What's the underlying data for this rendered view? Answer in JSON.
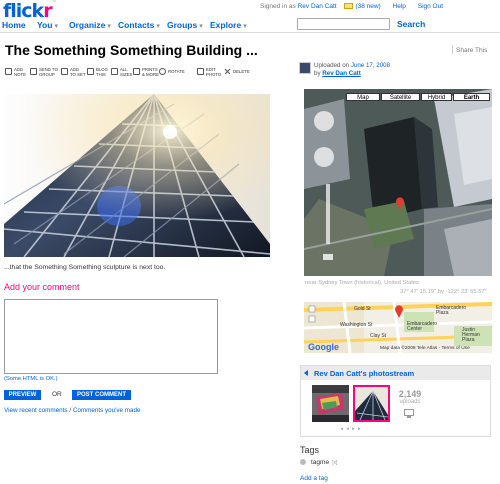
{
  "logo": {
    "part1": "flick",
    "part2": "r",
    "mark": "™"
  },
  "account": {
    "signed_in_as": "Signed in as",
    "user": "Rev Dan Catt",
    "mail_count": "(38 new)",
    "help": "Help",
    "sign_out": "Sign Out"
  },
  "nav": {
    "items": [
      {
        "label": "Home",
        "caret": false
      },
      {
        "label": "You",
        "caret": true
      },
      {
        "label": "Organize",
        "caret": true
      },
      {
        "label": "Contacts",
        "caret": true
      },
      {
        "label": "Groups",
        "caret": true
      },
      {
        "label": "Explore",
        "caret": true
      }
    ],
    "search_placeholder": "",
    "search_label": "Search",
    "caret_glyph": "▾"
  },
  "photo": {
    "title": "The Something Something Building ...",
    "caption": "...that the Something Something sculpture is next too.",
    "share_label": "Share This"
  },
  "toolbar": {
    "items": [
      {
        "label": "ADD\nNOTE",
        "icon": "note-icon"
      },
      {
        "label": "SEND TO\nGROUP",
        "icon": "group-icon"
      },
      {
        "label": "ADD\nTO SET",
        "icon": "set-icon"
      },
      {
        "label": "BLOG\nTHIS",
        "icon": "blog-icon"
      },
      {
        "label": "ALL\nSIZES",
        "icon": "sizes-icon"
      },
      {
        "label": "PRINTS\n& MORE",
        "icon": "prints-icon"
      },
      {
        "label": "ROTATE",
        "icon": "rotate-icon"
      },
      {
        "label": "EDIT\nPHOTO",
        "icon": "edit-icon"
      },
      {
        "label": "DELETE",
        "icon": "delete-icon"
      }
    ]
  },
  "comments": {
    "heading": "Add your comment",
    "html_note": "(Some HTML is OK.)",
    "preview_label": "PREVIEW",
    "or_label": "OR",
    "post_label": "POST COMMENT",
    "recent_link": "View recent comments",
    "separator": " / ",
    "yours_link": "Comments you've made"
  },
  "sidebar": {
    "uploaded_prefix": "Uploaded on",
    "uploaded_date": "June 17, 2008",
    "by_prefix": "by",
    "author": "Rev Dan Catt",
    "map_tabs": [
      "Map",
      "Satellite",
      "Hybrid",
      "Earth"
    ],
    "map_active_tab": "Earth",
    "location": "near Sydney Town (historical), United States",
    "coordinates": "37° 47' 15.19\" by -122° 23' 55.57\"",
    "street_labels": {
      "gold": "Gold St",
      "washington": "Washington St",
      "clay": "Clay St",
      "embarcadero_plaza": "Embarcadero\nPlaza",
      "embarcadero_center": "Embarcadero\nCenter",
      "justin": "Justin\nHerman\nPlaza"
    },
    "google": "Google",
    "map_copyright": "Map data ©2008 Tele Atlas · Terms of Use",
    "photostream_title": "Rev Dan Catt's photostream",
    "upload_count": "2,149",
    "upload_label": "uploads",
    "nav_arrows": "◂ ◂ ▸ ▸",
    "tags_heading": "Tags",
    "tags": [
      "tagme"
    ],
    "tag_remove": "[x]",
    "add_tag": "Add a tag"
  },
  "colors": {
    "link": "#0063dc",
    "brand_pink": "#ff0084",
    "button": "#0063dc"
  }
}
